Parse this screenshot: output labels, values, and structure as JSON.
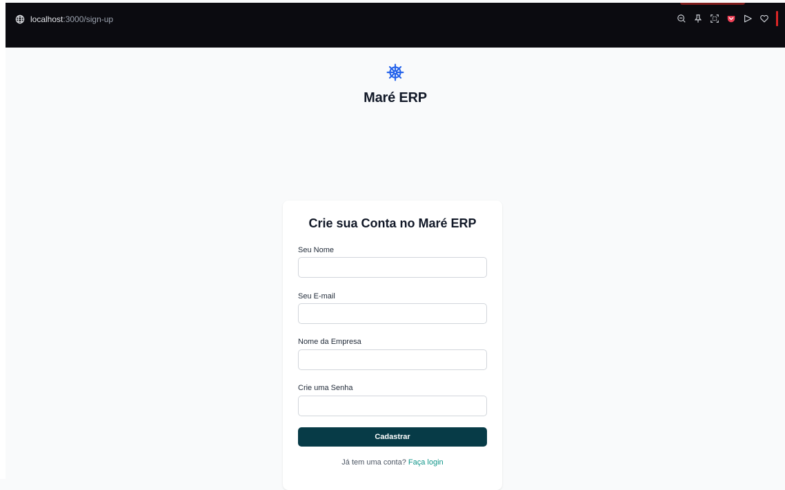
{
  "browser": {
    "url_host": "localhost",
    "url_path": ":3000/sign-up",
    "toolbar_icons": [
      "zoom-out-icon",
      "pin-icon",
      "screenshot-icon",
      "pocket-icon",
      "send-icon",
      "heart-icon"
    ],
    "accent_color": "#dc2626"
  },
  "brand": {
    "icon": "ship-wheel-icon",
    "icon_color": "#2563eb",
    "title": "Maré ERP"
  },
  "form": {
    "title": "Crie sua Conta no Maré ERP",
    "fields": [
      {
        "label": "Seu Nome",
        "value": "",
        "placeholder": ""
      },
      {
        "label": "Seu E-mail",
        "value": "",
        "placeholder": ""
      },
      {
        "label": "Nome da Empresa",
        "value": "",
        "placeholder": ""
      },
      {
        "label": "Crie uma Senha",
        "value": "",
        "placeholder": ""
      }
    ],
    "submit_label": "Cadastrar",
    "submit_color": "#073b47",
    "login_prompt": "Já tem uma conta?",
    "login_link": "Faça login",
    "link_color": "#0d9488"
  }
}
